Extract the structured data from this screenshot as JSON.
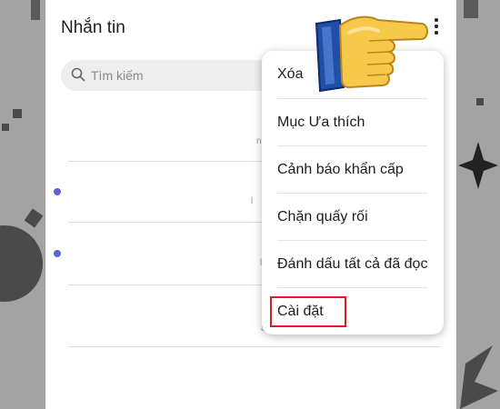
{
  "header": {
    "title": "Nhắn tin"
  },
  "search": {
    "placeholder": "Tìm kiếm"
  },
  "conversation_peeks": [
    "n",
    "l",
    "l",
    "ă"
  ],
  "menu": {
    "items": [
      {
        "label": "Xóa"
      },
      {
        "label": "Mục Ưa thích"
      },
      {
        "label": "Cảnh báo khẩn cấp"
      },
      {
        "label": "Chặn quấy rối"
      },
      {
        "label": "Đánh dấu tất cả đã đọc"
      },
      {
        "label": "Cài đặt"
      }
    ]
  },
  "colors": {
    "unread_dot": "#5b63d6",
    "highlight": "#e01b1b",
    "hand_cuff": "#1f4fa8",
    "hand_skin": "#f7c94a"
  }
}
